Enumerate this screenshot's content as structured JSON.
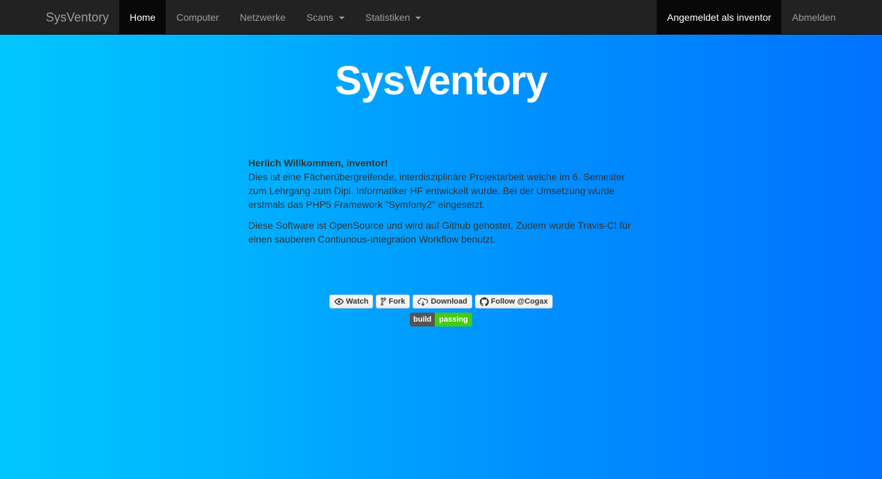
{
  "nav": {
    "brand": "SysVentory",
    "items": [
      {
        "label": "Home",
        "active": true
      },
      {
        "label": "Computer",
        "active": false
      },
      {
        "label": "Netzwerke",
        "active": false
      },
      {
        "label": "Scans",
        "active": false,
        "dropdown": true
      },
      {
        "label": "Statistiken",
        "active": false,
        "dropdown": true
      }
    ],
    "user_label": "Angemeldet als inventor",
    "logout_label": "Abmelden"
  },
  "hero": {
    "title": "SysVentory"
  },
  "content": {
    "greeting": "Herlich Willkommen, inventor!",
    "paragraph1": "Dies ist eine Fächerübergreifende, interdisziplinäre Projektarbeit welche im 6. Semester zum Lehrgang zum Dipl. Informatiker HF entwickelt wurde. Bei der Umsetzung wurde erstmals das PHP5 Framework \"Symfony2\" eingesetzt.",
    "paragraph2": "Diese Software ist OpenSource und wird auf Github gehostet. Zudem wurde Travis-CI für einen sauberen Contiunous-Integration Workflow benutzt."
  },
  "github": {
    "watch_label": "Watch",
    "fork_label": "Fork",
    "download_label": "Download",
    "follow_label": "Follow @Cogax"
  },
  "badge": {
    "left": "build",
    "right": "passing",
    "color": "#44cc11"
  },
  "colors": {
    "navbar": "#222222",
    "gradient_start": "#00c6ff",
    "gradient_end": "#0072ff"
  }
}
